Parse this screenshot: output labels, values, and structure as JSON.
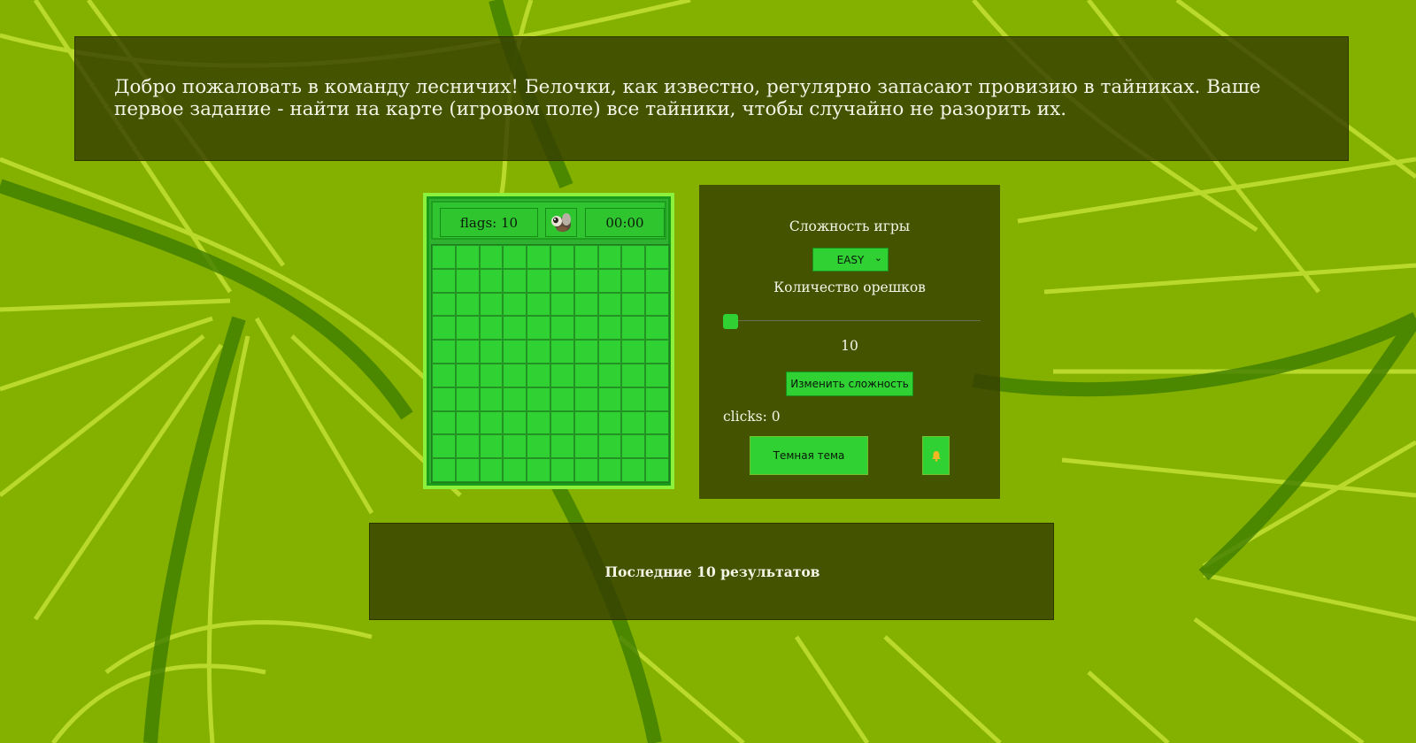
{
  "intro": {
    "text": "Добро пожаловать в команду лесничих! Белочки, как известно, регулярно запасают провизию в тайниках. Ваше первое задание - найти на карте (игровом поле) все тайники, чтобы случайно не разорить их."
  },
  "game": {
    "flags_label": "flags: 10",
    "timer": "00:00",
    "face_icon": "squirrel-icon",
    "rows": 10,
    "cols": 10
  },
  "settings": {
    "difficulty_label": "Сложность игры",
    "difficulty_value": "EASY",
    "nuts_label": "Количество орешков",
    "nuts_value": "10",
    "nuts_slider_fraction": 0,
    "apply_label": "Изменить сложность",
    "clicks_label": "clicks: 0",
    "theme_label": "Темная тема",
    "sound_icon": "bell-icon"
  },
  "results": {
    "title": "Последние 10 результатов"
  },
  "colors": {
    "background": "#84b000",
    "panel": "#363e00",
    "cell": "#2fd232",
    "accent": "#8cf13c"
  }
}
